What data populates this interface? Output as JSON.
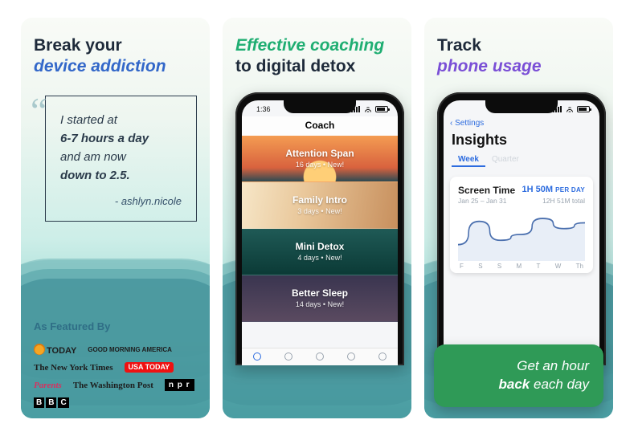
{
  "panels": [
    {
      "headline_plain": "Break your",
      "headline_accent": "device addiction",
      "quote_l1_a": "I started at",
      "quote_l2_a": "6-7 hours a day",
      "quote_l3_a": "and am now",
      "quote_l4_a": "down to 2.5.",
      "quote_author": "- ashlyn.nicole",
      "featured_label": "As Featured By",
      "logos": [
        "TODAY",
        "GOOD MORNING AMERICA",
        "The New York Times",
        "USA TODAY",
        "Parents",
        "The Washington Post",
        "n p r",
        "BBC"
      ]
    },
    {
      "headline_accent": "Effective coaching",
      "headline_plain": "to digital detox",
      "time": "1:36",
      "nav_title": "Coach",
      "cards": [
        {
          "title": "Attention Span",
          "sub": "16 days • New!"
        },
        {
          "title": "Family Intro",
          "sub": "3 days • New!"
        },
        {
          "title": "Mini Detox",
          "sub": "4 days • New!"
        },
        {
          "title": "Better Sleep",
          "sub": "14 days • New!"
        }
      ]
    },
    {
      "headline_plain": "Track",
      "headline_accent": "phone usage",
      "back_label": "Settings",
      "title": "Insights",
      "segments": [
        "Week",
        "Quarter"
      ],
      "card": {
        "label": "Screen Time",
        "value": "1H 50M",
        "value_suffix": "PER DAY",
        "range": "Jan 25 – Jan 31",
        "total": "12H 51M total"
      },
      "xaxis": [
        "F",
        "S",
        "S",
        "M",
        "T",
        "W",
        "Th"
      ],
      "callout_l1": "Get an hour",
      "callout_l2a": "back",
      "callout_l2b": " each day"
    }
  ],
  "chart_data": {
    "type": "line",
    "title": "Screen Time",
    "xlabel": "",
    "ylabel": "",
    "categories": [
      "F",
      "S",
      "S",
      "M",
      "T",
      "W",
      "Th"
    ],
    "values": [
      0.9,
      2.5,
      1.2,
      1.6,
      2.7,
      2.0,
      2.4
    ],
    "ylim": [
      0,
      3
    ],
    "unit": "hours per day",
    "aggregate_per_day": "1h 50m",
    "aggregate_total": "12h 51m",
    "range_label": "Jan 25 – Jan 31"
  }
}
